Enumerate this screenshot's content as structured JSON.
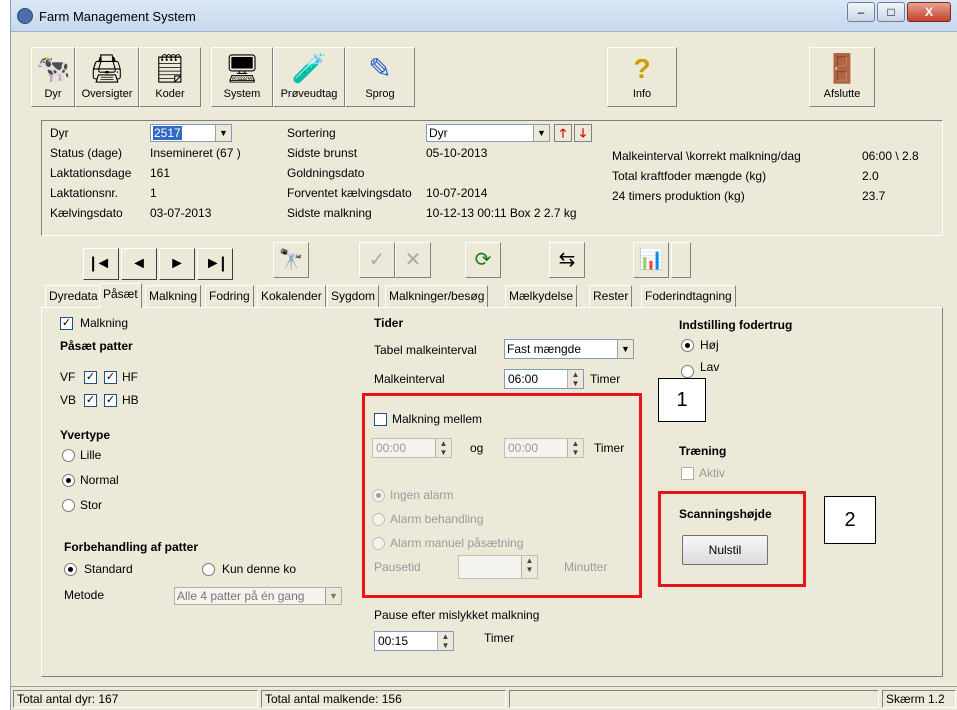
{
  "window": {
    "title": "Farm Management System",
    "minimize": "–",
    "maximize": "□",
    "close": "X"
  },
  "toolbar": [
    {
      "label": "Dyr",
      "icon": "cow-icon",
      "glyph": "🐄"
    },
    {
      "label": "Oversigter",
      "icon": "printer-icon",
      "glyph": "🖨"
    },
    {
      "label": "Koder",
      "icon": "list-icon",
      "glyph": "🗒"
    },
    {
      "label": "System",
      "icon": "computer-icon",
      "glyph": "🖥"
    },
    {
      "label": "Prøveudtag",
      "icon": "test-tubes-icon",
      "glyph": "🧪"
    },
    {
      "label": "Sprog",
      "icon": "pen-icon",
      "glyph": "✎"
    },
    {
      "label": "Info",
      "icon": "question-icon",
      "glyph": "?"
    },
    {
      "label": "Afslutte",
      "icon": "exit-door-icon",
      "glyph": "🚪"
    }
  ],
  "info": {
    "dyr_label": "Dyr",
    "dyr_value": "2517",
    "status_label": "Status (dage)",
    "status_value": "Insemineret (67 )",
    "laktdage_label": "Laktationsdage",
    "laktdage_value": "161",
    "laktnr_label": "Laktationsnr.",
    "laktnr_value": "1",
    "kaelv_label": "Kælvingsdato",
    "kaelv_value": "03-07-2013",
    "sortering_label": "Sortering",
    "sortering_value": "Dyr",
    "brunst_label": "Sidste brunst",
    "brunst_value": "05-10-2013",
    "goldning_label": "Goldningsdato",
    "forventet_label": "Forventet kælvingsdato",
    "forventet_value": "10-07-2014",
    "sidste_malk_label": "Sidste malkning",
    "sidste_malk_value": "10-12-13 00:11  Box 2  2.7 kg",
    "malkeinterval_label": "Malkeinterval \\korrekt malkning/dag",
    "malkeinterval_value": "06:00 \\ 2.8",
    "kraftfoder_label": "Total kraftfoder mængde (kg)",
    "kraftfoder_value": "2.0",
    "produktion_label": "24 timers produktion (kg)",
    "produktion_value": "23.7"
  },
  "nav": {
    "first": "|◄",
    "prev": "◄",
    "next": "►",
    "last": "►|"
  },
  "tabs": [
    "Dyredata",
    "Påsæt",
    "Malkning",
    "Fodring",
    "Kokalender",
    "Sygdom",
    "Malkninger/besøg",
    "Mælkydelse",
    "Rester",
    "Foderindtagning"
  ],
  "form": {
    "malkning": "Malkning",
    "paasaet_patter": "Påsæt patter",
    "vf": "VF",
    "hf": "HF",
    "vb": "VB",
    "hb": "HB",
    "yvertype": "Yvertype",
    "lille": "Lille",
    "normal": "Normal",
    "stor": "Stor",
    "forbehandling": "Forbehandling af patter",
    "standard": "Standard",
    "kun_denne": "Kun denne ko",
    "metode": "Metode",
    "metode_value": "Alle 4 patter på én gang",
    "tider": "Tider",
    "tabel_label": "Tabel malkeinterval",
    "tabel_value": "Fast mængde",
    "malkeinterval": "Malkeinterval",
    "malkeinterval_value": "06:00",
    "timer": "Timer",
    "malkning_mellem": "Malkning mellem",
    "from": "00:00",
    "og": "og",
    "to": "00:00",
    "ingen_alarm": "Ingen alarm",
    "alarm_beh": "Alarm behandling",
    "alarm_manuel": "Alarm manuel påsætning",
    "pausetid": "Pausetid",
    "minutter": "Minutter",
    "pause_efter": "Pause efter mislykket malkning",
    "pause_value": "00:15",
    "indstilling": "Indstilling fodertrug",
    "hoej": "Høj",
    "lav": "Lav",
    "traening": "Træning",
    "aktiv": "Aktiv",
    "scanning": "Scanningshøjde",
    "nulstil": "Nulstil"
  },
  "callouts": {
    "one": "1",
    "two": "2"
  },
  "status": {
    "total_dyr": "Total antal dyr: 167",
    "total_malkende": "Total antal malkende: 156",
    "skaerm": "Skærm 1.2"
  }
}
